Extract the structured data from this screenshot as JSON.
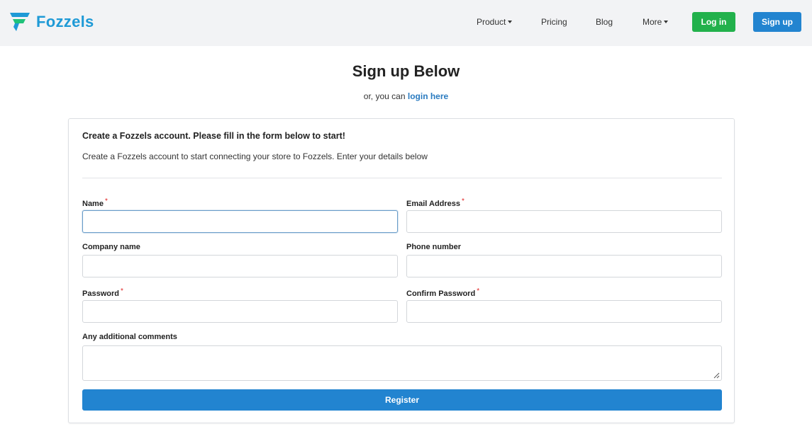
{
  "brand": {
    "name_part1": "Fozzels",
    "logo_icon": "fozzels-logo-icon",
    "primary_color": "#1f9ad6",
    "accent_color": "#1fc27a"
  },
  "nav": {
    "items": [
      {
        "label": "Product",
        "has_dropdown": true
      },
      {
        "label": "Pricing",
        "has_dropdown": false
      },
      {
        "label": "Blog",
        "has_dropdown": false
      },
      {
        "label": "More",
        "has_dropdown": true
      }
    ],
    "login_label": "Log in",
    "signup_label": "Sign up",
    "login_color": "#22b14c",
    "signup_color": "#2284d0"
  },
  "page": {
    "title": "Sign up Below",
    "subline_prefix": "or, you can",
    "subline_link": "login here"
  },
  "form": {
    "heading": "Create a Fozzels account. Please fill in the form below to start!",
    "description": "Create a Fozzels account to start connecting your store to Fozzels. Enter your details below",
    "required_marker": "*",
    "fields": {
      "name": {
        "label": "Name",
        "required": true,
        "value": ""
      },
      "email": {
        "label": "Email Address",
        "required": true,
        "value": ""
      },
      "company": {
        "label": "Company name",
        "required": false,
        "value": ""
      },
      "phone": {
        "label": "Phone number",
        "required": false,
        "value": ""
      },
      "password": {
        "label": "Password",
        "required": true,
        "value": ""
      },
      "confirm_password": {
        "label": "Confirm Password",
        "required": true,
        "value": ""
      },
      "comments": {
        "label": "Any additional comments",
        "required": false,
        "value": ""
      }
    },
    "submit_label": "Register"
  }
}
